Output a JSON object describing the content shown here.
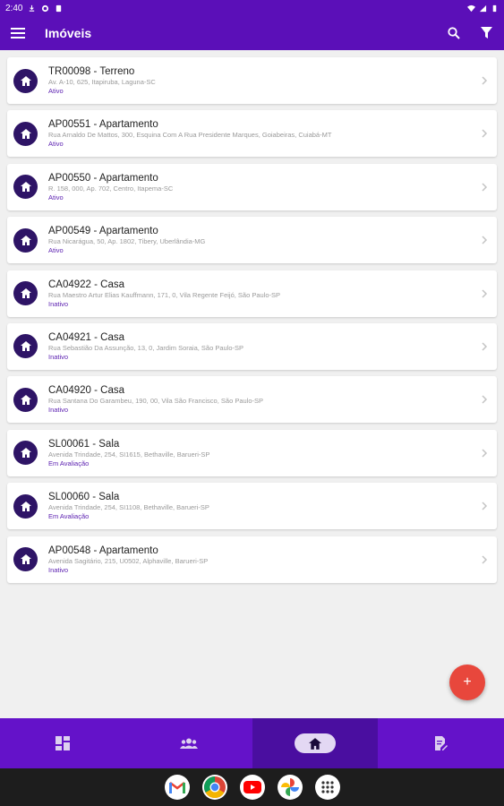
{
  "status_bar": {
    "time": "2:40"
  },
  "app_bar": {
    "title": "Imóveis"
  },
  "properties": [
    {
      "title": "TR00098 - Terreno",
      "address": "Av. A-10, 625, Itapiruba, Laguna-SC",
      "status": "Ativo"
    },
    {
      "title": "AP00551 - Apartamento",
      "address": "Rua Arnaldo De Mattos, 300, Esquina Com A Rua Presidente Marques, Goiabeiras, Cuiabá-MT",
      "status": "Ativo"
    },
    {
      "title": "AP00550 - Apartamento",
      "address": "R. 158, 000, Ap. 702, Centro, Itapema-SC",
      "status": "Ativo"
    },
    {
      "title": "AP00549 - Apartamento",
      "address": "Rua Nicarágua, 50, Ap. 1802, Tibery, Uberlândia-MG",
      "status": "Ativo"
    },
    {
      "title": "CA04922 - Casa",
      "address": "Rua Maestro Artur Elias Kauffmann, 171, 0, Vila Regente Feijó, São Paulo-SP",
      "status": "Inativo"
    },
    {
      "title": "CA04921 - Casa",
      "address": "Rua Sebastião Da Assunção, 13, 0, Jardim Soraia, São Paulo-SP",
      "status": "Inativo"
    },
    {
      "title": "CA04920 - Casa",
      "address": "Rua Santana Do Garambeu, 190, 00, Vila São Francisco, São Paulo-SP",
      "status": "Inativo"
    },
    {
      "title": "SL00061 - Sala",
      "address": "Avenida Trindade, 254, SI1615, Bethaville, Barueri-SP",
      "status": "Em Avaliação"
    },
    {
      "title": "SL00060 - Sala",
      "address": "Avenida Trindade, 254, SI1108, Bethaville, Barueri-SP",
      "status": "Em Avaliação"
    },
    {
      "title": "AP00548 - Apartamento",
      "address": "Avenida Sagitário, 215, U0502, Alphaville, Barueri-SP",
      "status": "Inativo"
    }
  ],
  "fab": {
    "label": "+"
  },
  "bottom_nav": [
    {
      "icon": "dashboard-icon",
      "active": false
    },
    {
      "icon": "people-icon",
      "active": false
    },
    {
      "icon": "home-icon",
      "active": true
    },
    {
      "icon": "contract-icon",
      "active": false
    }
  ],
  "taskbar_apps": [
    "gmail-icon",
    "chrome-icon",
    "youtube-icon",
    "google-photos-icon",
    "app-drawer-icon"
  ],
  "colors": {
    "primary": "#5b0fb8",
    "nav": "#6412c9",
    "fab": "#e8473c",
    "avatar": "#2e1466",
    "status_text": "#5b1fb0"
  }
}
